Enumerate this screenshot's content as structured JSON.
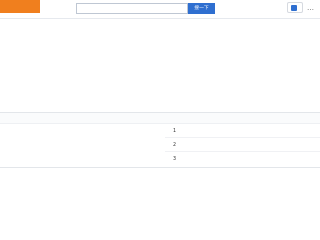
{
  "topbar": {
    "tag_label": "",
    "search_text": "",
    "search_button": "搜一下",
    "qr_label": "",
    "more_label": "…"
  },
  "title": "",
  "description": "",
  "table": {
    "header_seq": "",
    "header_unit": "",
    "merged_text": "",
    "rows": [
      {
        "seq": "1",
        "name": "",
        "link": ""
      },
      {
        "seq": "2",
        "name": "",
        "link": ""
      },
      {
        "seq": "3",
        "name": "",
        "link": ""
      }
    ]
  },
  "companies": [
    "",
    ""
  ]
}
